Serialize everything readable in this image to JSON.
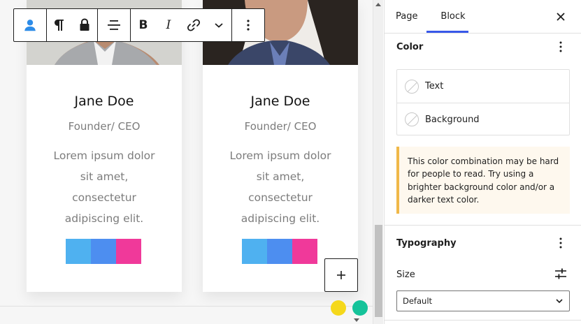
{
  "cards": [
    {
      "name": "Jane Doe",
      "role": "Founder/ CEO",
      "bio": [
        "Lorem ipsum dolor",
        "sit amet,",
        "consectetur",
        "adipiscing elit."
      ],
      "swatches": [
        "#4fb1f0",
        "#4d8ef0",
        "#f0399a"
      ]
    },
    {
      "name": "Jane Doe",
      "role": "Founder/ CEO",
      "bio": [
        "Lorem ipsum dolor",
        "sit amet,",
        "consectetur",
        "adipiscing elit."
      ],
      "swatches": [
        "#4fb1f0",
        "#4d8ef0",
        "#f0399a"
      ]
    }
  ],
  "toolbar": {
    "bold_label": "B",
    "italic_label": "I"
  },
  "sidebar": {
    "tab_page": "Page",
    "tab_block": "Block",
    "color_title": "Color",
    "text_label": "Text",
    "background_label": "Background",
    "notice": "This color combination may be hard for people to read. Try using a brighter background color and/or a darker text color.",
    "typography_title": "Typography",
    "size_label": "Size",
    "size_value": "Default"
  },
  "colors": {
    "accent": "#3858e9",
    "notice_border": "#f0b849",
    "notice_bg": "#fef8ee",
    "user_icon": "#2d8ce8",
    "grammarly_yellow": "#f5d81b",
    "grammarly_green": "#15c39a"
  }
}
